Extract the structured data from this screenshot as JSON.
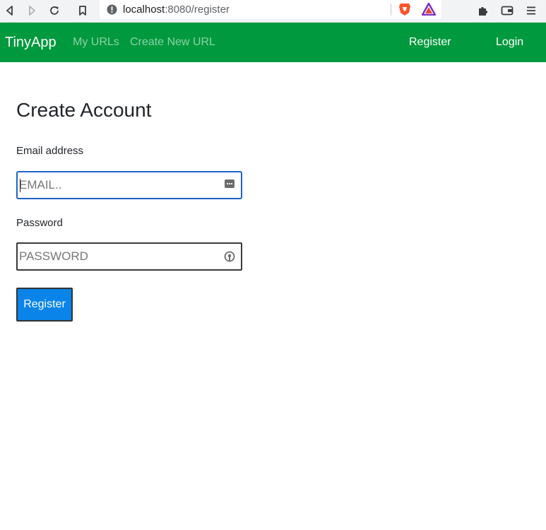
{
  "browser": {
    "url_host": "localhost",
    "url_path": ":8080/register"
  },
  "navbar": {
    "brand": "TinyApp",
    "links": [
      {
        "label": "My URLs"
      },
      {
        "label": "Create New URL"
      }
    ],
    "register_label": "Register",
    "login_label": "Login"
  },
  "form": {
    "title": "Create Account",
    "email_label": "Email address",
    "email_placeholder": "EMAIL..",
    "email_value": "",
    "password_label": "Password",
    "password_placeholder": "PASSWORD",
    "password_value": "",
    "submit_label": "Register"
  },
  "colors": {
    "navbar_bg": "#00993d",
    "button_bg": "#0a84e8",
    "focus_border": "#1e63c8"
  },
  "icons": {
    "back": "back-arrow-icon",
    "forward": "forward-arrow-icon",
    "reload": "reload-icon",
    "bookmark": "bookmark-icon",
    "site_info": "info-icon",
    "brave": "brave-shield-icon",
    "rewards": "brave-rewards-icon",
    "extensions": "puzzle-icon",
    "wallet": "wallet-icon",
    "menu": "hamburger-menu-icon",
    "email_autofill": "autofill-dots-icon",
    "password_manager": "password-key-icon"
  }
}
